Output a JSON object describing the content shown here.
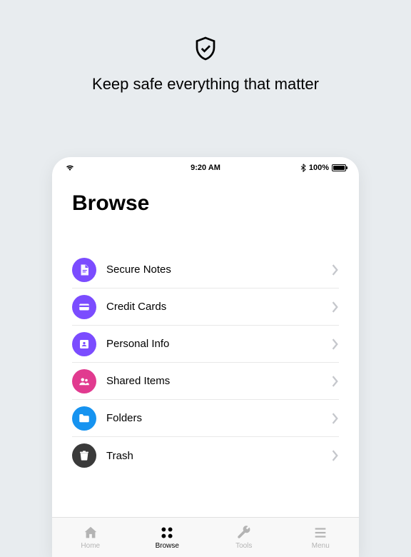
{
  "hero": {
    "text": "Keep safe everything that matter"
  },
  "status": {
    "time": "9:20 AM",
    "battery_text": "100%"
  },
  "screen": {
    "title": "Browse"
  },
  "colors": {
    "purple": "#7b4cff",
    "pink": "#e13a8f",
    "blue": "#1693f0",
    "dark": "#3a3a3a"
  },
  "categories": [
    {
      "label": "Secure Notes",
      "icon": "note-icon",
      "color": "#7b4cff"
    },
    {
      "label": "Credit Cards",
      "icon": "card-icon",
      "color": "#7b4cff"
    },
    {
      "label": "Personal Info",
      "icon": "person-icon",
      "color": "#7b4cff"
    },
    {
      "label": "Shared Items",
      "icon": "people-icon",
      "color": "#e13a8f"
    },
    {
      "label": "Folders",
      "icon": "folder-icon",
      "color": "#1693f0"
    },
    {
      "label": "Trash",
      "icon": "trash-icon",
      "color": "#3a3a3a"
    }
  ],
  "tabs": [
    {
      "label": "Home",
      "icon": "home-icon",
      "active": false
    },
    {
      "label": "Browse",
      "icon": "grid-icon",
      "active": true
    },
    {
      "label": "Tools",
      "icon": "wrench-icon",
      "active": false
    },
    {
      "label": "Menu",
      "icon": "menu-icon",
      "active": false
    }
  ]
}
